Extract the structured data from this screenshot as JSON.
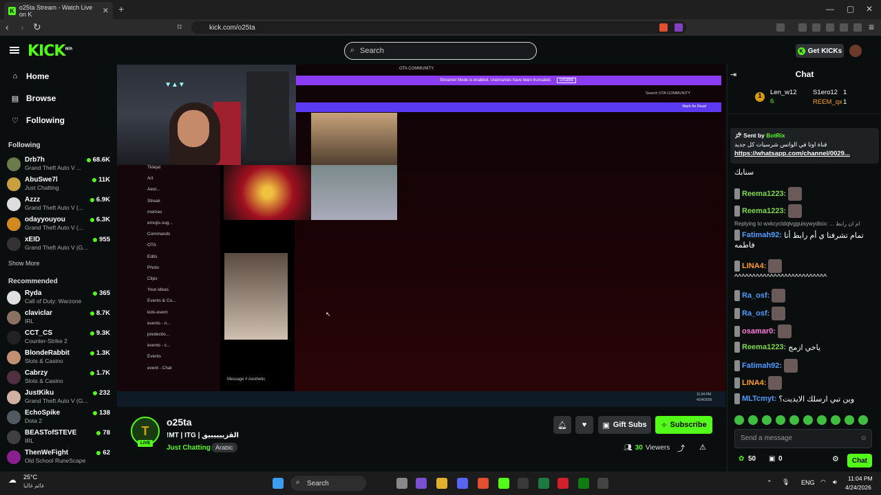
{
  "browser": {
    "tab_title": "o25ta Stream - Watch Live on K",
    "tab_favicon": "K",
    "url": "kick.com/o25ta"
  },
  "header": {
    "logo": "KICK",
    "logo_tag": "BETA",
    "search_placeholder": "Search",
    "get_kicks": "Get KICKs"
  },
  "sidebar": {
    "nav": [
      {
        "label": "Home",
        "icon": "home-icon"
      },
      {
        "label": "Browse",
        "icon": "browse-icon"
      },
      {
        "label": "Following",
        "icon": "heart-icon"
      }
    ],
    "following_title": "Following",
    "following": [
      {
        "name": "Drb7h",
        "game": "Grand Theft Auto V ...",
        "viewers": "68.6K",
        "color": "#6a7b4c"
      },
      {
        "name": "AbuSwe7l",
        "game": "Just Chatting",
        "viewers": "11K",
        "color": "#c8a040"
      },
      {
        "name": "Azzz",
        "game": "Grand Theft Auto V (...",
        "viewers": "6.9K",
        "color": "#dddddd"
      },
      {
        "name": "odayyouyou",
        "game": "Grand Theft Auto V (...",
        "viewers": "6.3K",
        "color": "#d08a20"
      },
      {
        "name": "xEID",
        "game": "Grand Theft Auto V (G...",
        "viewers": "955",
        "color": "#333333"
      }
    ],
    "show_more": "Show More",
    "recommended_title": "Recommended",
    "recommended": [
      {
        "name": "Ryda",
        "game": "Call of Duty: Warzone",
        "viewers": "365",
        "color": "#e0e0e0"
      },
      {
        "name": "claviclar",
        "game": "IRL",
        "viewers": "8.7K",
        "color": "#8a7060"
      },
      {
        "name": "CCT_CS",
        "game": "Counter-Strike 2",
        "viewers": "9.3K",
        "color": "#222222"
      },
      {
        "name": "BlondeRabbit",
        "game": "Slots & Casino",
        "viewers": "1.3K",
        "color": "#c09070"
      },
      {
        "name": "Cabrzy",
        "game": "Slots & Casino",
        "viewers": "1.7K",
        "color": "#503040"
      },
      {
        "name": "JustKiku",
        "game": "Grand Theft Auto V (G...",
        "viewers": "232",
        "color": "#d0b0a0"
      },
      {
        "name": "EchoSpike",
        "game": "Dota 2",
        "viewers": "138",
        "color": "#505a60"
      },
      {
        "name": "BEASTofSTEVE",
        "game": "IRL",
        "viewers": "78",
        "color": "#404040"
      },
      {
        "name": "ThenWeFight",
        "game": "Old School RuneScape",
        "viewers": "62",
        "color": "#8a2090"
      }
    ]
  },
  "video": {
    "discord_title": "OTA COMMUNITY",
    "streamer_mode": "Streamer Mode is enabled. Usernames have been truncated.",
    "disable": "Disable",
    "search_ota": "Search OTA COMMUNITY",
    "mark_read": "Mark As Read",
    "channels": [
      "Tklejat",
      "Art",
      "Aest...",
      "Streak",
      "memes",
      "emojis-sug...",
      "Commands",
      "OTA",
      "Edits",
      "Photo",
      "Clips",
      "Your-ideas",
      "Events & Co...",
      "kick-event",
      "events - n...",
      "predectio...",
      "events - c...",
      "Events",
      "event - Chat"
    ],
    "message_placeholder": "Message #",
    "aesthetic": "Aesthetic",
    "time": "11:04 PM",
    "date": "4/24/2026"
  },
  "stream": {
    "name": "o25ta",
    "live": "LIVE",
    "title": "!MT | ITG | القزييييييق",
    "category": "Just Chatting",
    "tag": "Arabic",
    "gift_subs": "Gift Subs",
    "subscribe": "Subscribe",
    "viewers_count": "30",
    "viewers_label": "Viewers"
  },
  "chat": {
    "title": "Chat",
    "leaders": [
      {
        "name": "Len_w12",
        "count": "6"
      },
      {
        "name": "S1ero12",
        "count": "1"
      },
      {
        "name": "REEM_qx",
        "count": "1"
      }
    ],
    "pinned_sender_label": "Sent by",
    "pinned_sender": "BotRix",
    "pinned_text": "قناة اوتا في الواتس شرسيات كل جديد",
    "pinned_link": "https://whatsapp.com/channel/0029...",
    "messages": [
      {
        "user": "",
        "text": "سنابك",
        "color": "#ffffff"
      },
      {
        "user": "Reema1223:",
        "text": "",
        "color": "#7fd84a"
      },
      {
        "user": "Reema1223:",
        "text": "",
        "color": "#7fd84a"
      },
      {
        "reply": "Replying to wxkcyctdqlvgguisywydisix: ... ام ان رابط"
      },
      {
        "user": "Fatimah92:",
        "text": "تمام تشرفنا ي أم رابط أنا",
        "color": "#4d9dff"
      },
      {
        "user": "",
        "text": "فاطمه",
        "color": "#ffffff"
      },
      {
        "user": "LINA4:",
        "text": "",
        "color": "#ff9f1a"
      },
      {
        "user": "",
        "text": "^^^^^^^^^^^^^^^^^^^^^^^^^^",
        "color": "#ffffff"
      },
      {
        "user": "Ra_osf:",
        "text": "",
        "color": "#4d9dff"
      },
      {
        "user": "Ra_osf:",
        "text": "",
        "color": "#4d9dff"
      },
      {
        "user": "osamar0:",
        "text": "",
        "color": "#ff7ad9"
      },
      {
        "user": "Reema1223:",
        "text": "ياخي ازمج",
        "color": "#7fd84a"
      },
      {
        "user": "Fatimah92:",
        "text": "",
        "color": "#4d9dff"
      },
      {
        "user": "LINA4:",
        "text": "",
        "color": "#ff9f1a"
      },
      {
        "user": "MLTcmyt:",
        "text": "وين تبي ارسلك الايديت؟",
        "color": "#4d9dff"
      }
    ],
    "send_placeholder": "Send a message",
    "kicks_count": "50",
    "gift_count": "0",
    "chat_button": "Chat"
  },
  "taskbar": {
    "weather_temp": "25°C",
    "weather_text": "غائم غالبا",
    "search": "Search",
    "lang": "ENG",
    "time": "11:04 PM",
    "date": "4/24/2026"
  }
}
